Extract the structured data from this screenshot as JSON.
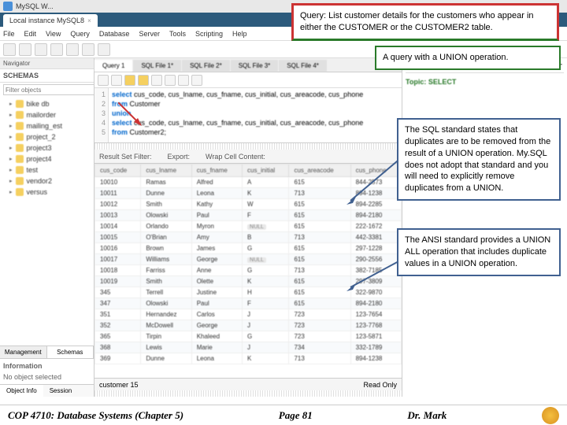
{
  "titlebar": {
    "text": "MySQL W..."
  },
  "home_tab": {
    "label": "Local instance MySQL8",
    "close": "×"
  },
  "menu": [
    "File",
    "Edit",
    "View",
    "Query",
    "Database",
    "Server",
    "Tools",
    "Scripting",
    "Help"
  ],
  "nav_label": "Navigator",
  "schemas_header": "SCHEMAS",
  "filter_placeholder": "Filter objects",
  "schemas": [
    "bike db",
    "mailorder",
    "mailing_est",
    "project_2",
    "project3",
    "project4",
    "test",
    "vendor2",
    "versus"
  ],
  "sidebar_tabs": {
    "mgmt": "Management",
    "schemas": "Schemas"
  },
  "info_hdr": "Information",
  "info_text": "No object selected",
  "bottom_tabs": {
    "obj": "Object Info",
    "sess": "Session"
  },
  "query_tabs": [
    "Query 1",
    "SQL File 1*",
    "SQL File 2*",
    "SQL File 3*",
    "SQL File 4*"
  ],
  "sql": {
    "lines": [
      "1",
      "2",
      "3",
      "4",
      "5"
    ],
    "code1a": "select",
    "code1b": " cus_code, cus_lname, cus_fname, cus_initial, cus_areacode, cus_phone",
    "code2a": "from",
    "code2b": " Customer",
    "code3a": "union",
    "code4a": "select",
    "code4b": " cus_code, cus_lname, cus_fname, cus_initial, cus_areacode, cus_phone",
    "code5a": "from",
    "code5b": " Customer2;"
  },
  "result_hdr": {
    "filter": "Result Set Filter:",
    "export": "Export:",
    "wrap": "Wrap Cell Content:"
  },
  "columns": [
    "cus_code",
    "cus_lname",
    "cus_fname",
    "cus_initial",
    "cus_areacode",
    "cus_phone"
  ],
  "rows": [
    [
      "10010",
      "Ramas",
      "Alfred",
      "A",
      "615",
      "844-2573"
    ],
    [
      "10011",
      "Dunne",
      "Leona",
      "K",
      "713",
      "894-1238"
    ],
    [
      "10012",
      "Smith",
      "Kathy",
      "W",
      "615",
      "894-2285"
    ],
    [
      "10013",
      "Olowski",
      "Paul",
      "F",
      "615",
      "894-2180"
    ],
    [
      "10014",
      "Orlando",
      "Myron",
      "NULL",
      "615",
      "222-1672"
    ],
    [
      "10015",
      "O'Brian",
      "Amy",
      "B",
      "713",
      "442-3381"
    ],
    [
      "10016",
      "Brown",
      "James",
      "G",
      "615",
      "297-1228"
    ],
    [
      "10017",
      "Williams",
      "George",
      "NULL",
      "615",
      "290-2556"
    ],
    [
      "10018",
      "Farriss",
      "Anne",
      "G",
      "713",
      "382-7185"
    ],
    [
      "10019",
      "Smith",
      "Olette",
      "K",
      "615",
      "297-3809"
    ],
    [
      "345",
      "Terrell",
      "Justine",
      "H",
      "615",
      "322-9870"
    ],
    [
      "347",
      "Olowski",
      "Paul",
      "F",
      "615",
      "894-2180"
    ],
    [
      "351",
      "Hernandez",
      "Carlos",
      "J",
      "723",
      "123-7654"
    ],
    [
      "352",
      "McDowell",
      "George",
      "J",
      "723",
      "123-7768"
    ],
    [
      "365",
      "Tirpin",
      "Khaleed",
      "G",
      "723",
      "123-5871"
    ],
    [
      "368",
      "Lewis",
      "Marie",
      "J",
      "734",
      "332-1789"
    ],
    [
      "369",
      "Dunne",
      "Leona",
      "K",
      "713",
      "894-1238"
    ]
  ],
  "result_footer": {
    "left": "customer 15",
    "right": "Read Only"
  },
  "rightpane": {
    "nav": "< >",
    "select": "SELECT",
    "topic": "Topic: SELECT"
  },
  "callouts": {
    "query": "Query: List customer details for the customers who appear in either the CUSTOMER or the CUSTOMER2 table.",
    "union": "A query with a UNION operation.",
    "std": "The SQL standard states that duplicates are to be removed from the result of a UNION operation. My.SQL does not adopt that standard and you will need to explicitly remove duplicates from a UNION.",
    "ansi": "The ANSI standard provides a UNION ALL operation that includes duplicate values in a UNION operation."
  },
  "footer": {
    "left": "COP 4710: Database Systems (Chapter 5)",
    "mid": "Page 81",
    "right": "Dr. Mark"
  }
}
